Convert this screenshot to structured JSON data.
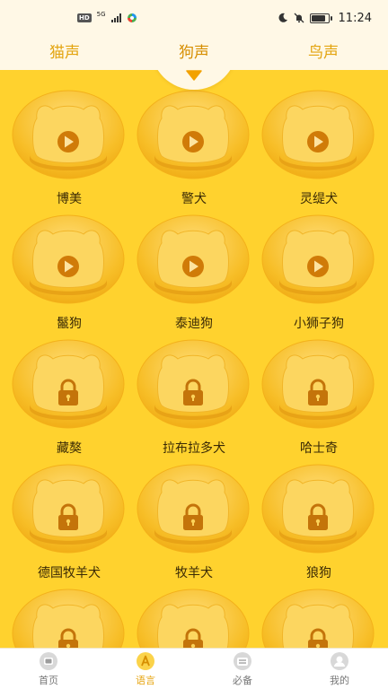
{
  "status_bar": {
    "hd_label": "HD",
    "network_label": "5G",
    "time": "11:24"
  },
  "tabs": [
    {
      "label": "猫声",
      "active": false
    },
    {
      "label": "狗声",
      "active": true
    },
    {
      "label": "鸟声",
      "active": false
    }
  ],
  "sounds": [
    {
      "name": "博美",
      "locked": false
    },
    {
      "name": "警犬",
      "locked": false
    },
    {
      "name": "灵缇犬",
      "locked": false
    },
    {
      "name": "鬣狗",
      "locked": false
    },
    {
      "name": "泰迪狗",
      "locked": false
    },
    {
      "name": "小狮子狗",
      "locked": false
    },
    {
      "name": "藏獒",
      "locked": true
    },
    {
      "name": "拉布拉多犬",
      "locked": true
    },
    {
      "name": "哈士奇",
      "locked": true
    },
    {
      "name": "德国牧羊犬",
      "locked": true
    },
    {
      "name": "牧羊犬",
      "locked": true
    },
    {
      "name": "狼狗",
      "locked": true
    },
    {
      "name": "",
      "locked": true
    },
    {
      "name": "",
      "locked": true
    },
    {
      "name": "",
      "locked": true
    }
  ],
  "bottom_nav": {
    "home": {
      "label": "首页",
      "icon": "home-icon",
      "active": false
    },
    "language": {
      "label": "语言",
      "icon": "language-icon",
      "active": true
    },
    "essentials": {
      "label": "必备",
      "icon": "essentials-icon",
      "active": false
    },
    "mine": {
      "label": "我的",
      "icon": "profile-icon",
      "active": false
    }
  },
  "colors": {
    "background": "#FFD22E",
    "header": "#FFF8E6",
    "bowl_outer": "#F6B81C",
    "bowl_inner": "#FBD25A",
    "icon": "#D07B08",
    "accent": "#E7A512"
  }
}
